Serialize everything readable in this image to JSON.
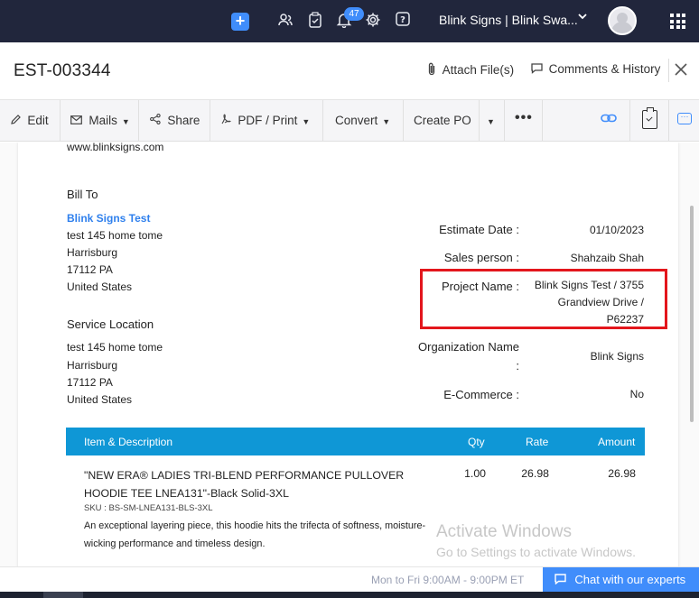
{
  "topnav": {
    "notifications_count": "47",
    "org_name": "Blink Signs | Blink Swa...",
    "icons": [
      "plus-icon",
      "contacts-icon",
      "tasks-icon",
      "bell-icon",
      "gear-icon",
      "help-icon",
      "apps-grid-icon"
    ]
  },
  "header": {
    "title": "EST-003344",
    "attach_label": "Attach File(s)",
    "comments_label": "Comments & History"
  },
  "toolbar": {
    "edit": "Edit",
    "mails": "Mails",
    "share": "Share",
    "pdf_print": "PDF / Print",
    "convert": "Convert",
    "create_po": "Create PO"
  },
  "document": {
    "website": "www.blinksigns.com",
    "bill_to": {
      "heading": "Bill To",
      "name": "Blink Signs Test",
      "line1": "test 145 home tome",
      "line2": "Harrisburg",
      "line3": "17112 PA",
      "line4": "United States"
    },
    "service_location": {
      "heading": "Service Location",
      "line1": "test 145 home tome",
      "line2": "Harrisburg",
      "line3": "17112 PA",
      "line4": "United States"
    },
    "details": {
      "estimate_date_label": "Estimate Date :",
      "estimate_date": "01/10/2023",
      "sales_person_label": "Sales person :",
      "sales_person": "Shahzaib Shah",
      "project_name_label": "Project Name :",
      "project_name_line1": "Blink Signs Test / 3755",
      "project_name_line2": "Grandview Drive /",
      "project_name_line3": "P62237",
      "organization_label_line1": "Organization Name",
      "organization_label_line2": ":",
      "organization": "Blink Signs",
      "ecommerce_label": "E-Commerce :",
      "ecommerce": "No"
    },
    "table": {
      "headers": [
        "Item & Description",
        "Qty",
        "Rate",
        "Amount"
      ],
      "item": {
        "title": "\"NEW ERA® LADIES TRI-BLEND PERFORMANCE PULLOVER HOODIE TEE LNEA131\"-Black Solid-3XL",
        "sku": "SKU : BS-SM-LNEA131-BLS-3XL",
        "description": "An exceptional layering piece, this hoodie hits the trifecta of softness, moisture-wicking performance and timeless design.",
        "qty": "1.00",
        "rate": "26.98",
        "amount": "26.98"
      }
    }
  },
  "watermark": {
    "line1": "Activate Windows",
    "line2": "Go to Settings to activate Windows."
  },
  "footer": {
    "hours": "Mon to Fri 9:00AM - 9:00PM ET",
    "chat_button": "Chat with our experts"
  }
}
